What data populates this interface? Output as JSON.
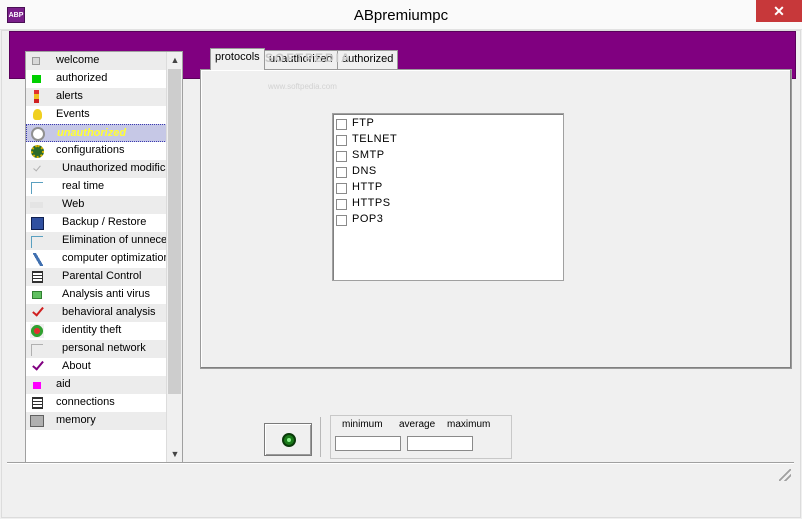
{
  "window": {
    "title": "ABpremiumpc",
    "icon_text": "ABP",
    "close_glyph": "✕"
  },
  "sidebar": {
    "items": [
      {
        "label": "welcome",
        "icon": "welcome-icon"
      },
      {
        "label": "authorized",
        "icon": "green-square-icon"
      },
      {
        "label": "alerts",
        "icon": "alert-figure-icon"
      },
      {
        "label": "Events",
        "icon": "lightbulb-icon"
      },
      {
        "label": "unauthorized",
        "icon": "blocked-circle-icon",
        "selected": true
      },
      {
        "label": "configurations",
        "icon": "config-gear-icon"
      },
      {
        "label": "Unauthorized modifica",
        "icon": "checkmark-light-icon"
      },
      {
        "label": "real time",
        "icon": "clock-icon"
      },
      {
        "label": "Web",
        "icon": "http-icon"
      },
      {
        "label": "Backup / Restore",
        "icon": "backup-disk-icon"
      },
      {
        "label": "Elimination of unneces",
        "icon": "trash-icon"
      },
      {
        "label": "computer optimization",
        "icon": "optimization-icon"
      },
      {
        "label": "Parental Control",
        "icon": "document-icon"
      },
      {
        "label": "Analysis anti virus",
        "icon": "green-box-icon"
      },
      {
        "label": "behavioral analysis",
        "icon": "red-check-icon"
      },
      {
        "label": "identity theft",
        "icon": "identity-icon"
      },
      {
        "label": "personal network",
        "icon": "network-icon"
      },
      {
        "label": "About",
        "icon": "about-check-icon"
      },
      {
        "label": "aid",
        "icon": "magenta-square-icon"
      },
      {
        "label": "connections",
        "icon": "connections-icon"
      },
      {
        "label": "memory",
        "icon": "memory-chip-icon"
      }
    ]
  },
  "tabs": [
    {
      "label": "protocols",
      "active": true
    },
    {
      "label": "unauthorized",
      "active": false
    },
    {
      "label": "authorized",
      "active": false
    }
  ],
  "watermark": {
    "text": "SOFTPEDIA",
    "url": "www.softpedia.com"
  },
  "protocols": [
    {
      "label": "FTP",
      "checked": false
    },
    {
      "label": "TELNET",
      "checked": false
    },
    {
      "label": "SMTP",
      "checked": false
    },
    {
      "label": "DNS",
      "checked": false
    },
    {
      "label": "HTTP",
      "checked": false
    },
    {
      "label": "HTTPS",
      "checked": false
    },
    {
      "label": "POP3",
      "checked": false
    }
  ],
  "stats": {
    "minimum_label": "minimum",
    "average_label": "average",
    "maximum_label": "maximum"
  },
  "colors": {
    "header_purple": "#800080",
    "selection": "#c6c8e6",
    "selected_text": "#ffff33",
    "close_red": "#c7383a"
  }
}
